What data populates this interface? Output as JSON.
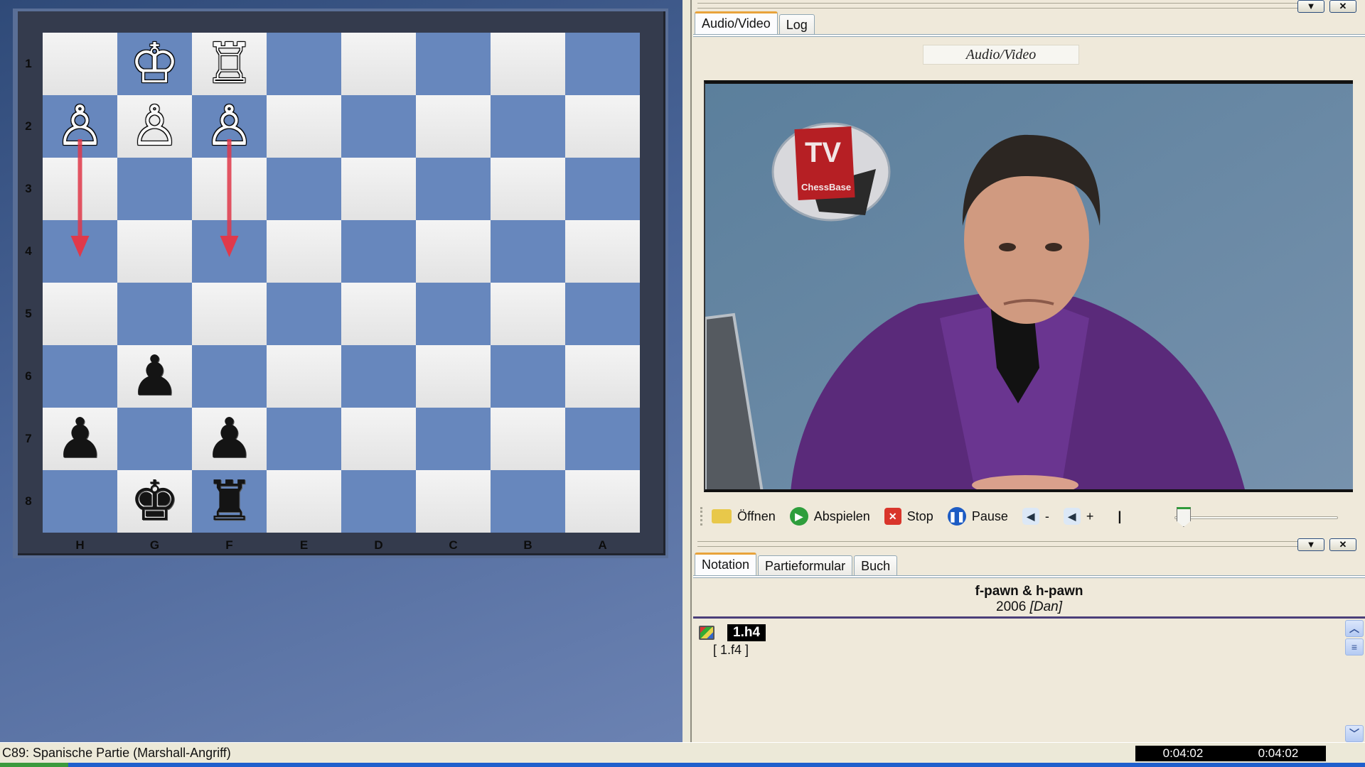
{
  "board": {
    "rank_labels": [
      "1",
      "2",
      "3",
      "4",
      "5",
      "6",
      "7",
      "8"
    ],
    "file_labels": [
      "H",
      "G",
      "F",
      "E",
      "D",
      "C",
      "B",
      "A"
    ],
    "orientation": "black-at-bottom",
    "colors": {
      "light_square": "#ededed",
      "dark_square": "#6787bd",
      "arrow": "#e0394a"
    },
    "pieces": [
      {
        "square": "g1",
        "color": "white",
        "type": "king",
        "glyph": "♔"
      },
      {
        "square": "f1",
        "color": "white",
        "type": "rook",
        "glyph": "♖"
      },
      {
        "square": "h2",
        "color": "white",
        "type": "pawn",
        "glyph": "♙"
      },
      {
        "square": "g2",
        "color": "white",
        "type": "pawn",
        "glyph": "♙"
      },
      {
        "square": "f2",
        "color": "white",
        "type": "pawn",
        "glyph": "♙"
      },
      {
        "square": "g6",
        "color": "black",
        "type": "pawn",
        "glyph": "♟"
      },
      {
        "square": "h7",
        "color": "black",
        "type": "pawn",
        "glyph": "♟"
      },
      {
        "square": "f7",
        "color": "black",
        "type": "pawn",
        "glyph": "♟"
      },
      {
        "square": "g8",
        "color": "black",
        "type": "king",
        "glyph": "♚"
      },
      {
        "square": "f8",
        "color": "black",
        "type": "rook",
        "glyph": "♜"
      }
    ],
    "arrows": [
      {
        "from": "h2",
        "to": "h4"
      },
      {
        "from": "f2",
        "to": "f4"
      }
    ]
  },
  "av_pane": {
    "tabs": [
      {
        "label": "Audio/Video",
        "active": true
      },
      {
        "label": "Log",
        "active": false
      }
    ],
    "title": "Audio/Video",
    "video_logo": {
      "big": "TV",
      "small": "ChessBase"
    },
    "toolbar": {
      "open": "Öffnen",
      "play": "Abspielen",
      "stop": "Stop",
      "pause": "Pause",
      "vol_down": "-",
      "vol_up": "+",
      "separator": "|"
    },
    "position_fraction": 0.03
  },
  "window_buttons": {
    "menu": "▼",
    "close": "✕"
  },
  "notation_pane": {
    "tabs": [
      {
        "label": "Notation",
        "active": true
      },
      {
        "label": "Partieformular",
        "active": false
      },
      {
        "label": "Buch",
        "active": false
      }
    ],
    "game_title": "f-pawn & h-pawn",
    "game_year": "2006",
    "game_annotator": "[Dan]",
    "current_move": "1.h4",
    "variation": "[ 1.f4 ]"
  },
  "statusbar": {
    "opening": "C89: Spanische Partie (Marshall-Angriff)",
    "time_elapsed": "0:04:02",
    "time_total": "0:04:02"
  }
}
